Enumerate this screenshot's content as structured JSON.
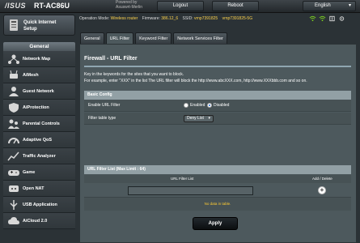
{
  "header": {
    "brand": "/ISUS",
    "model": "RT-AC86U",
    "powered_by": "Powered by",
    "powered_name": "Asuswrt-Merlin",
    "logout": "Logout",
    "reboot": "Reboot",
    "language": "English"
  },
  "status": {
    "op_mode_label": "Operation Mode:",
    "op_mode_value": "Wireless router",
    "firmware_label": "Firmware:",
    "firmware_value": "386.12_6",
    "ssid_label": "SSID:",
    "ssid_value1": "vrnp7391825",
    "ssid_value2": "vrnp7391825-5G"
  },
  "sidebar": {
    "qis_label_line1": "Quick Internet",
    "qis_label_line2": "Setup",
    "section": "General",
    "items": [
      {
        "label": "Network Map",
        "icon": "network-map-icon"
      },
      {
        "label": "AiMesh",
        "icon": "aimesh-icon"
      },
      {
        "label": "Guest Network",
        "icon": "guest-network-icon"
      },
      {
        "label": "AiProtection",
        "icon": "aiprotection-icon"
      },
      {
        "label": "Parental Controls",
        "icon": "parental-controls-icon"
      },
      {
        "label": "Adaptive QoS",
        "icon": "adaptive-qos-icon"
      },
      {
        "label": "Traffic Analyzer",
        "icon": "traffic-analyzer-icon"
      },
      {
        "label": "Game",
        "icon": "game-icon"
      },
      {
        "label": "Open NAT",
        "icon": "open-nat-icon"
      },
      {
        "label": "USB Application",
        "icon": "usb-application-icon"
      },
      {
        "label": "AiCloud 2.0",
        "icon": "aicloud-icon"
      }
    ]
  },
  "tabs": [
    "General",
    "URL Filter",
    "Keyword Filter",
    "Network Services Filter"
  ],
  "content": {
    "title": "Firewall - URL Filter",
    "desc1": "Key in the keywords for the sites that you want to block.",
    "desc2": "For example, enter \"XXX\" in the list The URL filter will block the http://www.abcXXX.com, http://www.XXXbbb.com and so on.",
    "basic_config": "Basic Config",
    "enable_label": "Enable URL Filter",
    "enabled": "Enabled",
    "disabled": "Disabled",
    "filter_type_label": "Filter table type",
    "filter_type_value": "Deny List",
    "list_header": "URL Filter List (Max Limit : 64)",
    "col_url": "URL Filter List",
    "col_add": "Add / Delete",
    "no_data": "No data in table.",
    "apply": "Apply"
  }
}
